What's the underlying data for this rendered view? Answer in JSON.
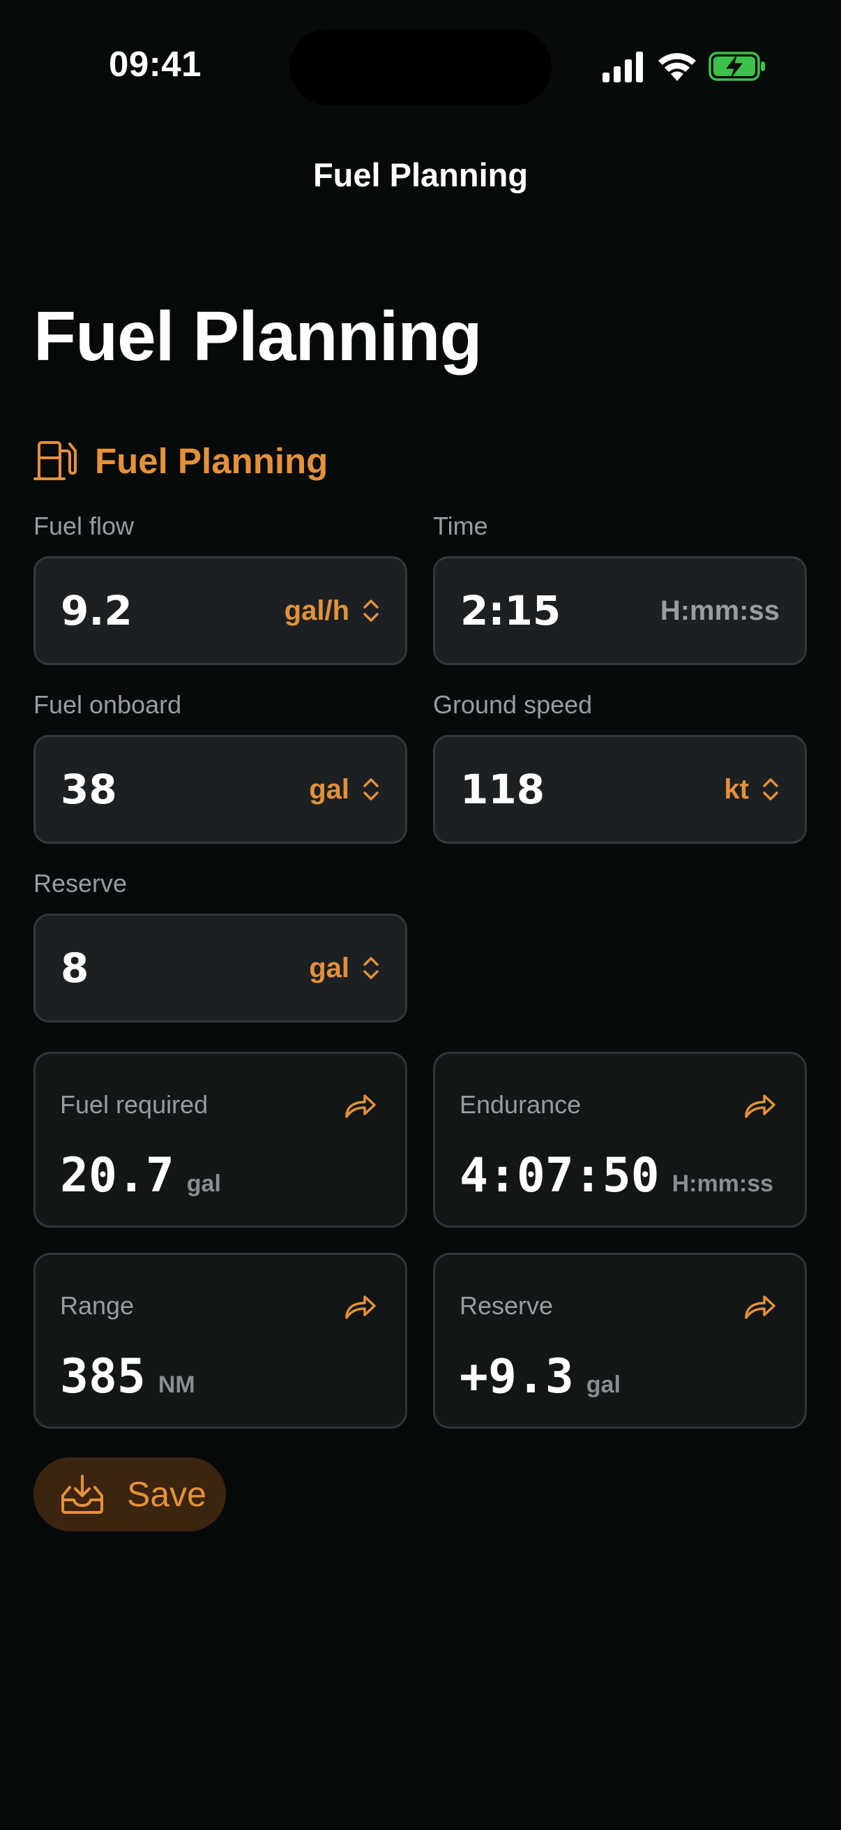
{
  "status_bar": {
    "time": "09:41"
  },
  "nav": {
    "title": "Fuel Planning"
  },
  "page": {
    "large_title": "Fuel Planning"
  },
  "section": {
    "label": "Fuel Planning",
    "icon": "fuel-pump-icon"
  },
  "inputs": {
    "fuel_flow": {
      "label": "Fuel flow",
      "value": "9.2",
      "unit": "gal/h"
    },
    "time": {
      "label": "Time",
      "value": "2:15",
      "unit": "H:mm:ss"
    },
    "fuel_onboard": {
      "label": "Fuel onboard",
      "value": "38",
      "unit": "gal"
    },
    "ground_speed": {
      "label": "Ground speed",
      "value": "118",
      "unit": "kt"
    },
    "reserve": {
      "label": "Reserve",
      "value": "8",
      "unit": "gal"
    }
  },
  "results": {
    "fuel_required": {
      "label": "Fuel required",
      "value": "20.7",
      "unit": "gal"
    },
    "endurance": {
      "label": "Endurance",
      "value": "4:07:50",
      "unit": "H:mm:ss"
    },
    "range": {
      "label": "Range",
      "value": "385",
      "unit": "NM"
    },
    "reserve": {
      "label": "Reserve",
      "value": "+9.3",
      "unit": "gal"
    }
  },
  "actions": {
    "save_label": "Save"
  },
  "colors": {
    "accent": "#e4913a",
    "background": "#070a0b",
    "field_background": "#1c2022",
    "card_background": "#121617",
    "secondary_text": "#9a9d9f",
    "battery_green": "#3cc24a"
  }
}
